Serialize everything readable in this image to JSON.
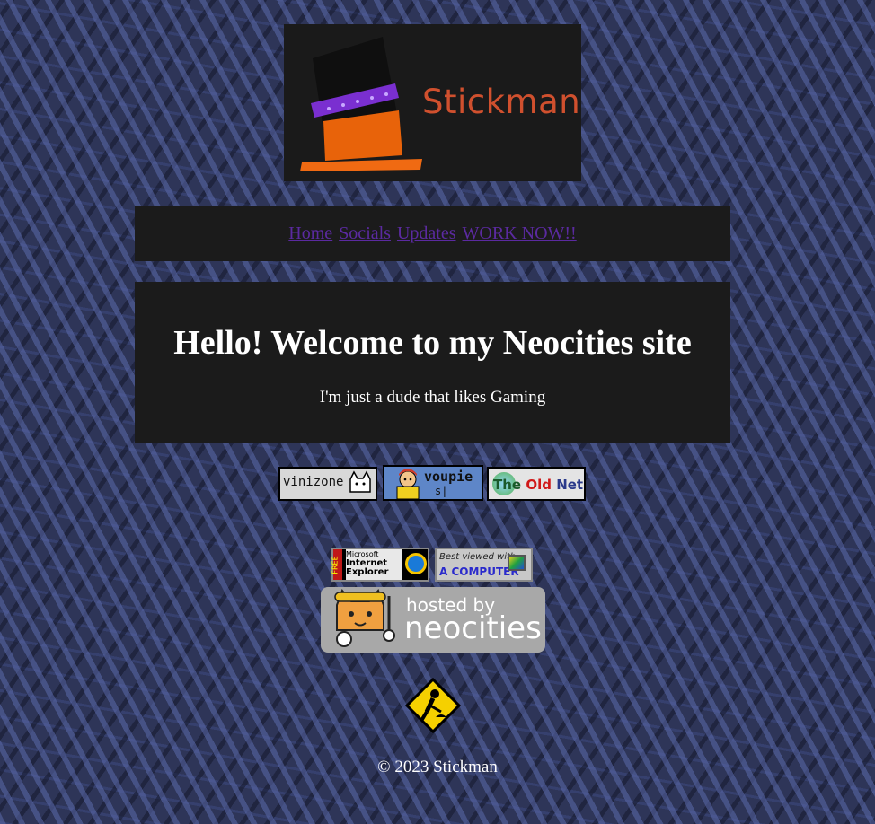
{
  "logo": {
    "text": "Stickman"
  },
  "nav": {
    "links": [
      {
        "label": "Home"
      },
      {
        "label": "Socials"
      },
      {
        "label": "Updates"
      },
      {
        "label": "WORK NOW!!"
      }
    ]
  },
  "main": {
    "heading": "Hello! Welcome to my Neocities site",
    "tagline": "I'm just a dude that likes Gaming"
  },
  "buttons": {
    "vinizone": "vinizone",
    "voupie": "voupie",
    "voupie_sub": "s|",
    "oldnet_the": "The",
    "oldnet_old": "Old",
    "oldnet_net": "Net"
  },
  "badges": {
    "ie_free": "FREE",
    "ie_line1": "Microsoft",
    "ie_line2": "Internet",
    "ie_line3": "Explorer",
    "computer_line1": "Best viewed with",
    "computer_line2": "A COMPUTER",
    "neocities_line1": "hosted by",
    "neocities_line2": "neocities"
  },
  "footer": {
    "text": "© 2023 Stickman"
  },
  "colors": {
    "panel": "#1b1b1b",
    "link": "#5b2aa0",
    "logo_text": "#d0502e",
    "hat_band": "#7a2fd0",
    "hat_orange": "#e8630a"
  }
}
